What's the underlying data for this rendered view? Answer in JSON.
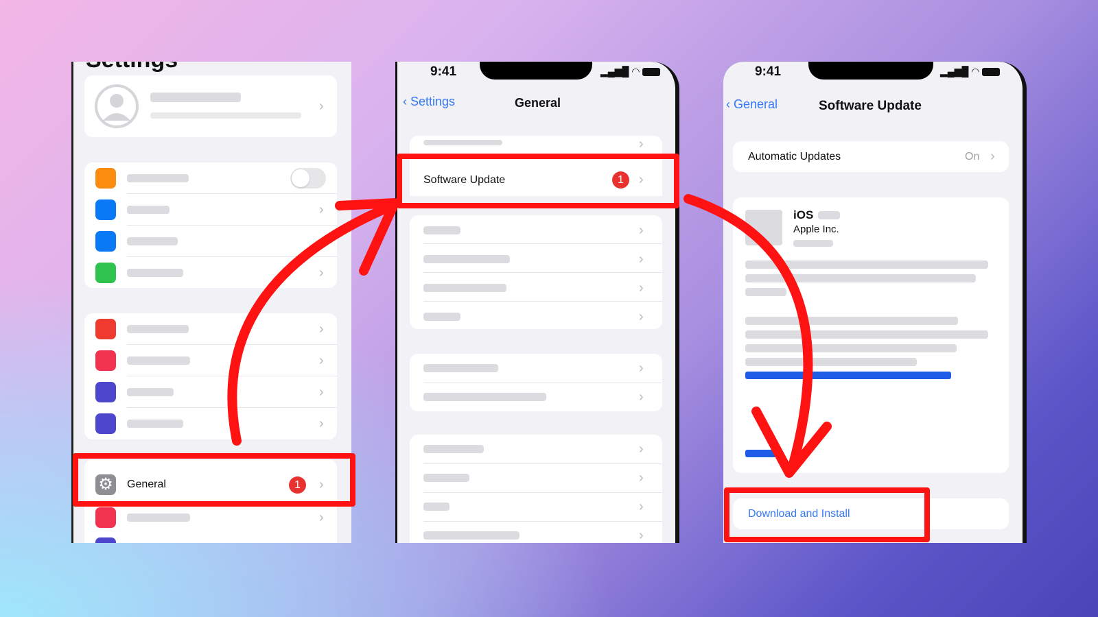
{
  "panel1": {
    "title": "Settings",
    "general_label": "General",
    "general_badge": "1"
  },
  "panel2": {
    "time": "9:41",
    "back_label": "Settings",
    "title": "General",
    "software_update_label": "Software Update",
    "badge": "1"
  },
  "panel3": {
    "time": "9:41",
    "back_label": "General",
    "title": "Software Update",
    "automatic_updates_label": "Automatic Updates",
    "automatic_updates_value": "On",
    "os_name": "iOS",
    "vendor": "Apple Inc.",
    "download_label": "Download and Install"
  },
  "colors": {
    "highlight": "#ff1212",
    "accent": "#3478f6",
    "badge": "#e8322f",
    "progress": "#1f5ce6"
  },
  "icons": [
    "person-icon",
    "gear-icon",
    "chevron-right-icon",
    "chevron-left-icon",
    "signal-icon",
    "wifi-icon",
    "battery-icon",
    "curved-arrow-icon"
  ]
}
